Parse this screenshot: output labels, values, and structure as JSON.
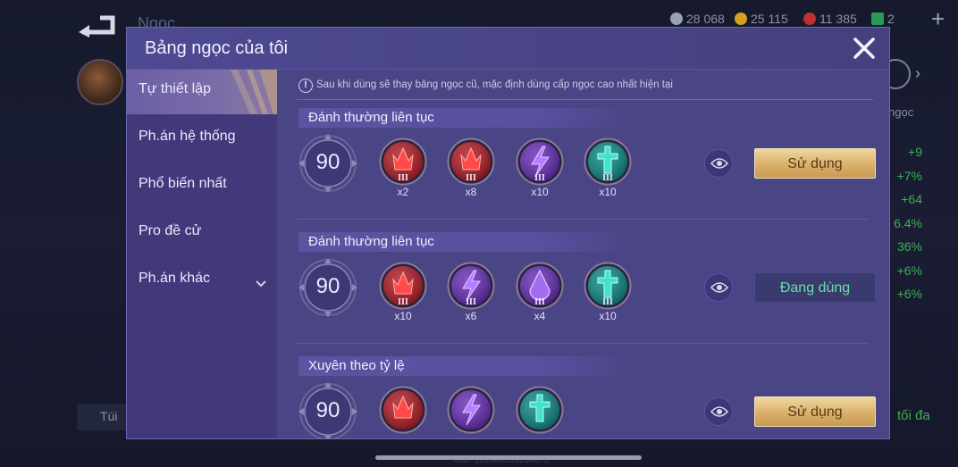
{
  "background": {
    "title": "Ngọc",
    "currencies": [
      {
        "value": "28 068",
        "color": "#9aa0b5"
      },
      {
        "value": "25 115",
        "color": "#d9a020"
      },
      {
        "value": "11 385",
        "color": "#c03030"
      },
      {
        "value": "2",
        "color": "#2a9a5a"
      }
    ],
    "side_label": "ngọc",
    "stats": [
      "+9",
      "+7%",
      "+64",
      "6.4%",
      "36%",
      "+6%",
      "+6%"
    ],
    "bag_label": "Túi",
    "max_label": "tối đa",
    "uid": "UID: 1a1000531234873"
  },
  "dialog": {
    "title": "Bảng ngọc của tôi",
    "sidebar": [
      {
        "label": "Tự thiết lập",
        "active": true
      },
      {
        "label": "Ph.án hệ thống",
        "active": false
      },
      {
        "label": "Phổ biến nhất",
        "active": false
      },
      {
        "label": "Pro đề cử",
        "active": false
      },
      {
        "label": "Ph.án khác",
        "active": false,
        "has_dropdown": true
      }
    ],
    "notice": "Sau khi dùng sẽ thay bảng ngọc cũ, mặc định dùng cấp ngọc cao nhất hiện tại",
    "notice_icon": "!",
    "pages": [
      {
        "name": "Đánh thường liên tục",
        "level": "90",
        "gems": [
          {
            "type": "red",
            "tier": "III",
            "count": "x2"
          },
          {
            "type": "red",
            "tier": "III",
            "count": "x8"
          },
          {
            "type": "purple-bolt",
            "tier": "III",
            "count": "x10"
          },
          {
            "type": "green",
            "tier": "III",
            "count": "x10"
          }
        ],
        "button_label": "Sử dụng",
        "button_style": "gold"
      },
      {
        "name": "Đánh thường liên tục",
        "level": "90",
        "gems": [
          {
            "type": "red",
            "tier": "III",
            "count": "x10"
          },
          {
            "type": "purple-bolt",
            "tier": "III",
            "count": "x6"
          },
          {
            "type": "purple-drop",
            "tier": "III",
            "count": "x4"
          },
          {
            "type": "green",
            "tier": "III",
            "count": "x10"
          }
        ],
        "button_label": "Đang dùng",
        "button_style": "dark"
      },
      {
        "name": "Xuyên theo tỷ lệ",
        "level": "90",
        "gems": [
          {
            "type": "red",
            "tier": "",
            "count": ""
          },
          {
            "type": "purple-bolt",
            "tier": "",
            "count": ""
          },
          {
            "type": "green",
            "tier": "",
            "count": ""
          }
        ],
        "button_label": "Sử dụng",
        "button_style": "gold"
      }
    ]
  },
  "colors": {
    "gem_red": "#b3202a",
    "gem_purple": "#6a32b8",
    "gem_green": "#138c8a",
    "gold_button": "#d8b06a",
    "active_text": "#63e0a8"
  }
}
